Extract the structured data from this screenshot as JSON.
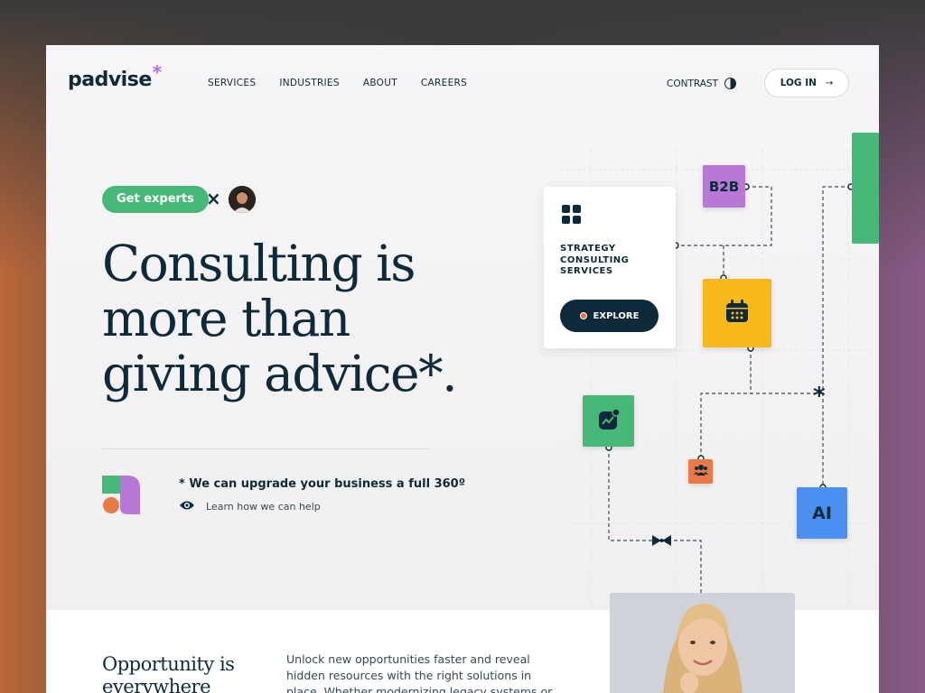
{
  "nav": {
    "logo": "padvise",
    "logo_star": "*",
    "links": [
      "SERVICES",
      "INDUSTRIES",
      "ABOUT",
      "CAREERS"
    ],
    "contrast_label": "CONTRAST",
    "login_label": "LOG IN",
    "login_arrow": "→"
  },
  "hero": {
    "pill_label": "Get experts",
    "x_mark": "×",
    "headline": [
      "Consulting is",
      "more than",
      "giving advice*."
    ],
    "tagline": "* We can upgrade your business a full 360º",
    "learn_label": "Learn how we can help"
  },
  "card": {
    "title": "STRATEGY CONSULTING SERVICES",
    "explore_label": "EXPLORE"
  },
  "tiles": {
    "b2b": "B2B",
    "ai": "AI"
  },
  "bottom": {
    "title": [
      "Opportunity is",
      "everywhere"
    ],
    "body": "Unlock new opportunities faster and reveal hidden resources with the right solutions in place. Whether modernizing legacy systems or"
  },
  "colors": {
    "navy": "#0e2a3a",
    "green": "#47b878",
    "purple": "#b978d6",
    "yellow": "#f9b81c",
    "orange": "#ea7a45",
    "blue": "#4b8ff0"
  }
}
